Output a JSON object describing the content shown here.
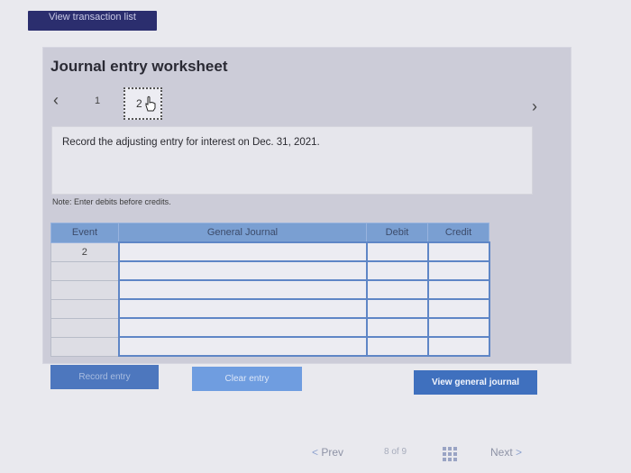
{
  "top_button": {
    "label": "View transaction list"
  },
  "worksheet": {
    "title": "Journal entry worksheet",
    "steps": [
      {
        "label": "1"
      },
      {
        "label": "2"
      }
    ],
    "instruction": "Record the adjusting entry for interest on Dec. 31, 2021.",
    "note": "Note: Enter debits before credits."
  },
  "table": {
    "headers": {
      "event": "Event",
      "journal": "General Journal",
      "debit": "Debit",
      "credit": "Credit"
    },
    "event_value": "2"
  },
  "buttons": {
    "record": "Record entry",
    "clear": "Clear entry",
    "view_journal": "View general journal"
  },
  "pagination": {
    "prev": "Prev",
    "page_count": "8 of 9",
    "next": "Next"
  }
}
